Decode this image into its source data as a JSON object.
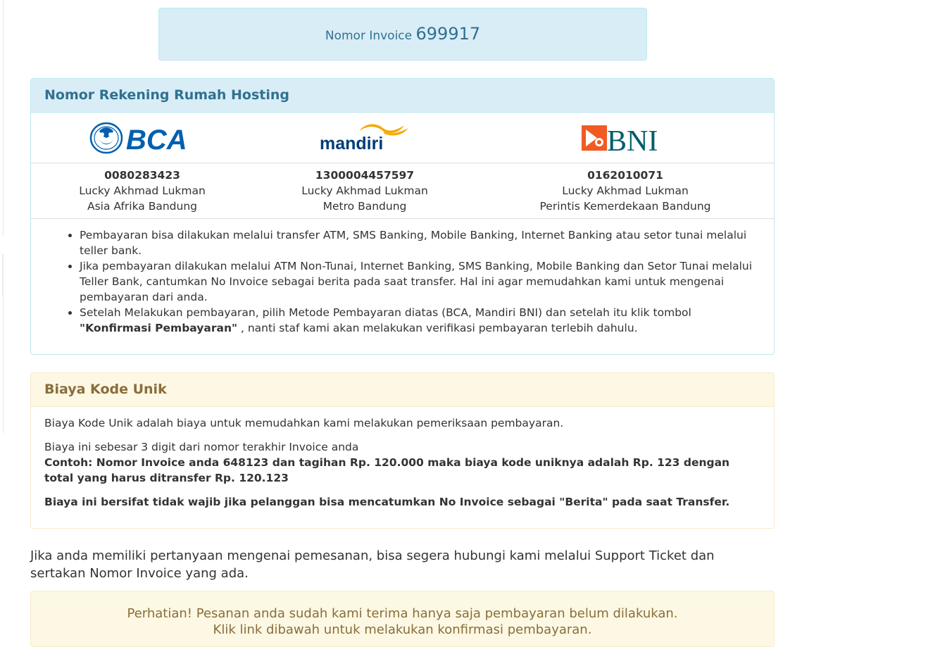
{
  "invoice": {
    "label": "Nomor Invoice",
    "number": "699917"
  },
  "bank_panel": {
    "title": "Nomor Rekening Rumah Hosting",
    "banks": [
      {
        "logo": "BCA",
        "number": "0080283423",
        "holder": "Lucky Akhmad Lukman",
        "branch": "Asia Afrika Bandung"
      },
      {
        "logo": "mandiri",
        "number": "1300004457597",
        "holder": "Lucky Akhmad Lukman",
        "branch": "Metro Bandung"
      },
      {
        "logo": "BNI",
        "number": "0162010071",
        "holder": "Lucky Akhmad Lukman",
        "branch": "Perintis Kemerdekaan Bandung"
      }
    ],
    "notes": [
      "Pembayaran bisa dilakukan melalui transfer ATM, SMS Banking, Mobile Banking, Internet Banking atau setor tunai melalui teller bank.",
      "Jika pembayaran dilakukan melalui ATM Non-Tunai, Internet Banking, SMS Banking, Mobile Banking dan Setor Tunai melalui Teller Bank, cantumkan No Invoice sebagai berita pada saat transfer. Hal ini agar memudahkan kami untuk mengenai pembayaran dari anda.",
      {
        "before": "Setelah Melakukan pembayaran, pilih Metode Pembayaran diatas (BCA, Mandiri BNI) dan setelah itu klik tombol ",
        "bold": "\"Konfirmasi Pembayaran\"",
        "after": " , nanti staf kami akan melakukan verifikasi pembayaran terlebih dahulu."
      }
    ]
  },
  "unique_code_panel": {
    "title": "Biaya Kode Unik",
    "p1": "Biaya Kode Unik adalah biaya untuk memudahkan kami melakukan pemeriksaan pembayaran.",
    "p2": "Biaya ini sebesar 3 digit dari nomor terakhir Invoice anda",
    "example": "Contoh: Nomor Invoice anda 648123 dan tagihan Rp. 120.000 maka biaya kode uniknya adalah Rp. 123 dengan total yang harus ditransfer Rp. 120.123",
    "note": "Biaya ini bersifat tidak wajib jika pelanggan bisa mencatumkan No Invoice sebagai \"Berita\" pada saat Transfer."
  },
  "question_text": "Jika anda memiliki pertanyaan mengenai pemesanan, bisa segera hubungi kami melalui Support Ticket dan sertakan Nomor Invoice yang ada.",
  "attention": {
    "line1": "Perhatian! Pesanan anda sudah kami terima hanya saja pembayaran belum dilakukan.",
    "line2": "Klik link dibawah untuk melakukan konfirmasi pembayaran."
  },
  "colors": {
    "info_bg": "#d9edf7",
    "info_text": "#31708f",
    "warn_bg": "#fcf8e3",
    "warn_text": "#8a6d3b",
    "bca_blue": "#0060af",
    "mandiri_navy": "#003d79",
    "mandiri_gold": "#f5a800",
    "bni_orange": "#f15a23",
    "bni_teal": "#005e6a"
  }
}
